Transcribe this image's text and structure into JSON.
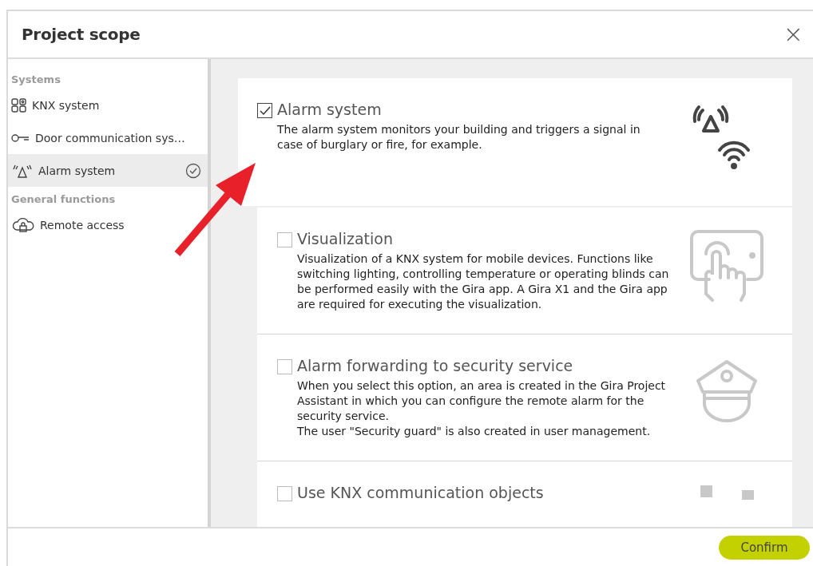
{
  "window": {
    "title": "Project scope",
    "close": "×"
  },
  "sidebar": {
    "sections": [
      {
        "heading": "Systems",
        "items": [
          {
            "label": "KNX system",
            "kind": "grid",
            "selected": false,
            "done": false
          },
          {
            "label": "Door communication sys…",
            "kind": "key",
            "selected": false,
            "done": false
          },
          {
            "label": "Alarm system",
            "kind": "alarm",
            "selected": true,
            "done": true
          }
        ]
      },
      {
        "heading": "General functions",
        "items": [
          {
            "label": "Remote access",
            "kind": "cloud",
            "selected": false,
            "done": false
          }
        ]
      }
    ]
  },
  "options": [
    {
      "title": "Alarm system",
      "description": "The alarm system monitors your building and triggers a signal in case of burglary or fire, for example.",
      "checked": true,
      "selected": true,
      "kind": "alarm"
    },
    {
      "title": "Visualization",
      "description": "Visualization of a KNX system for mobile devices. Functions like switching lighting, controlling temperature or operating blinds can be performed easily with the Gira app. A Gira X1 and the Gira app are required for executing the visualization.",
      "checked": false,
      "selected": false,
      "kind": "touch"
    },
    {
      "title": "Alarm forwarding to security service",
      "description": "When you select this option, an area is created in the Gira Project Assistant in which you can configure the remote alarm for the security service.\nThe user \"Security guard\" is also created in user management.",
      "checked": false,
      "selected": false,
      "kind": "guard"
    },
    {
      "title": "Use KNX communication objects",
      "checked": false,
      "selected": false,
      "kind": "objects"
    }
  ],
  "footer": {
    "confirm": "Confirm"
  }
}
